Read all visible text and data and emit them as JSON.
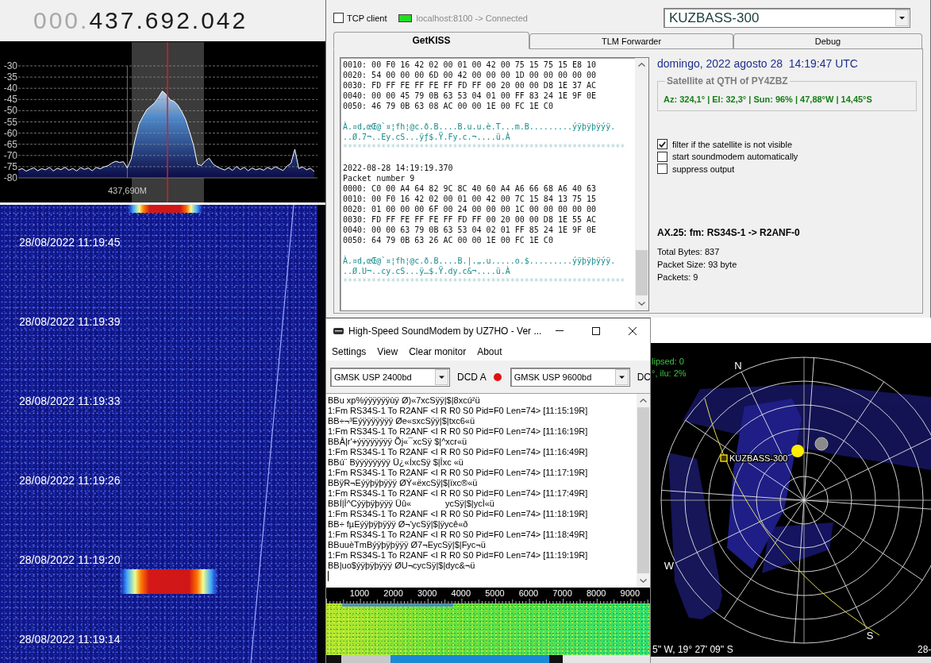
{
  "sdr": {
    "frequency": {
      "dim": "000.",
      "digits": "437.692.042"
    },
    "spectrum": {
      "chart_data": {
        "type": "line",
        "grid": true,
        "ylim": [
          -80,
          -30
        ],
        "yticks": [
          {
            "value": -30,
            "label": "-30"
          },
          {
            "value": -35,
            "label": "-35"
          },
          {
            "value": -40,
            "label": "-40"
          },
          {
            "value": -45,
            "label": "-45"
          },
          {
            "value": -50,
            "label": "-50"
          },
          {
            "value": -55,
            "label": "-55"
          },
          {
            "value": -60,
            "label": "-60"
          },
          {
            "value": -65,
            "label": "-65"
          },
          {
            "value": -70,
            "label": "-70"
          },
          {
            "value": -75,
            "label": "-75"
          },
          {
            "value": -80,
            "label": "-80"
          }
        ],
        "series": [
          {
            "color": "#ffffff",
            "values": [
              -76.5,
              -75.8,
              -77.0,
              -76.2,
              -75.5,
              -76.8,
              -75.9,
              -76.4,
              -75.3,
              -76.9,
              -75.7,
              -76.3,
              -75.2,
              -76.6,
              -75.8,
              -76.9,
              -75.4,
              -76.2,
              -75.6,
              -76.8,
              -75.3,
              -76.0,
              -75.1,
              -74.6,
              -73.4,
              -72.6,
              -73.1,
              -72.8,
              -75.6,
              -71.5,
              -63.0,
              -56.0,
              -52.5,
              -49.5,
              -48.0,
              -46.5,
              -44.0,
              -41.2,
              -42.8,
              -45.2,
              -45.8,
              -47.6,
              -50.5,
              -54.0,
              -59.5,
              -65.5,
              -74.0,
              -74.5,
              -72.5,
              -71.2,
              -73.8,
              -75.0,
              -75.8,
              -76.5,
              -75.4,
              -76.7,
              -74.9,
              -76.3,
              -75.2,
              -76.8,
              -75.6,
              -76.4,
              -75.9,
              -76.6,
              -75.3,
              -76.2,
              -75.0,
              -75.9,
              -76.7,
              -74.8,
              -73.5,
              -67.2,
              -75.8,
              -75.1,
              -76.4,
              -75.7,
              -77.2
            ]
          }
        ],
        "annotations": [
          {
            "text": "437,690M"
          }
        ]
      }
    },
    "waterfall": {
      "timestamps": [
        "28/08/2022 11:19:45",
        "28/08/2022 11:19:39",
        "28/08/2022 11:19:33",
        "28/08/2022 11:19:26",
        "28/08/2022 11:19:20",
        "28/08/2022 11:19:14"
      ]
    }
  },
  "getkiss": {
    "tcp_client": {
      "label": "TCP client",
      "checked": false
    },
    "connection": {
      "connected": true,
      "status": "localhost:8100 -> Connected"
    },
    "satellite": "KUZBASS-300",
    "tabs": [
      {
        "label": "GetKISS",
        "selected": true
      },
      {
        "label": "TLM Forwarder",
        "selected": false
      },
      {
        "label": "Debug",
        "selected": false
      }
    ],
    "log": [
      {
        "kind": "text",
        "text": "0010: 00 F0 16 42 02 00 01 00 42 00 75 15 75 15 E8 10"
      },
      {
        "kind": "text",
        "text": "0020: 54 00 00 00 6D 00 42 00 00 00 1D 00 00 00 00 00"
      },
      {
        "kind": "text",
        "text": "0030: FD FF FE FF FE FF FD FF 00 20 00 00 D8 1E 37 AC"
      },
      {
        "kind": "text",
        "text": "0040: 00 00 45 79 0B 63 53 04 01 00 FF 83 24 1E 9F 0E"
      },
      {
        "kind": "text",
        "text": "0050: 46 79 0B 63 08 AC 00 00 1E 00 FC 1E C0"
      },
      {
        "kind": "blank"
      },
      {
        "kind": "ascii",
        "text": "À.¤d,œŒ@`¤¦fh¦@c.ð.B....B.u.u.è.T...m.B.........ýÿþÿþÿýÿ."
      },
      {
        "kind": "ascii",
        "text": "..Ø.7¬..Ey.cS...ÿƒ$.Ÿ.Fy.c.¬....ü.À"
      },
      {
        "kind": "separator",
        "text": "***********************************************************"
      },
      {
        "kind": "blank"
      },
      {
        "kind": "text",
        "text": "2022-08-28 14:19:19.370"
      },
      {
        "kind": "text",
        "text": "Packet number 9"
      },
      {
        "kind": "text",
        "text": "0000: C0 00 A4 64 82 9C 8C 40 60 A4 A6 66 68 A6 40 63"
      },
      {
        "kind": "text",
        "text": "0010: 00 F0 16 42 02 00 01 00 42 00 7C 15 84 13 75 15"
      },
      {
        "kind": "text",
        "text": "0020: 01 00 00 00 6F 00 24 00 00 00 1C 00 00 00 00 00"
      },
      {
        "kind": "text",
        "text": "0030: FD FF FE FF FE FF FD FF 00 20 00 00 D8 1E 55 AC"
      },
      {
        "kind": "text",
        "text": "0040: 00 00 63 79 0B 63 53 04 02 01 FF 85 24 1E 9F 0E"
      },
      {
        "kind": "text",
        "text": "0050: 64 79 0B 63 26 AC 00 00 1E 00 FC 1E C0"
      },
      {
        "kind": "blank"
      },
      {
        "kind": "ascii",
        "text": "À.¤d,œŒ@`¤¦fh¦@c.ð.B....B.|.„.u.....o.$.........ýÿþÿþÿýÿ."
      },
      {
        "kind": "ascii",
        "text": "..Ø.U¬..cy.cS...ÿ…$.Ÿ.dy.c&¬....ü.À"
      },
      {
        "kind": "separator",
        "text": "***********************************************************"
      }
    ],
    "datetime": "domingo, 2022 agosto 28  14:19:47 UTC",
    "qth": {
      "title": "Satellite at QTH of PY4ZBZ",
      "position": "Az: 324,1° | El: 32,3° | Sun: 96% | 47,88°W | 14,45°S"
    },
    "options": [
      {
        "label": "filter if the satellite is not visible",
        "checked": true
      },
      {
        "label": "start soundmodem automatically",
        "checked": false
      },
      {
        "label": "suppress output",
        "checked": false
      }
    ],
    "ax25": "AX.25: fm: RS34S-1 -> R2ANF-0",
    "stats": [
      "Total Bytes: 837",
      "Packet Size: 93 byte",
      "Packets: 9"
    ]
  },
  "soundmodem": {
    "title": "High-Speed SoundModem by UZ7HO - Ver ...",
    "menu": [
      "Settings",
      "View",
      "Clear monitor",
      "About"
    ],
    "modem_a": {
      "mode": "GMSK USP 2400bd",
      "dcd_label": "DCD A",
      "dcd_lit": true
    },
    "modem_b": {
      "mode": "GMSK USP 9600bd",
      "dcd_label": "DC"
    },
    "monitor": [
      "BBu xp%ýÿÿÿÿÿùÿ Ø)«7xcSÿÿ|$|8xcú²ü",
      "1:Fm RS34S-1 To R2ANF <I R R0 S0 Pid=F0 Len=74> [11:15:19R]",
      "BB÷¬³Eýÿÿÿÿÿÿÿ Øe«sxcSÿÿ|$|txc6«ü",
      "1:Fm RS34S-1 To R2ANF <I R R0 S0 Pid=F0 Len=74> [11:16:19R]",
      "BBÂ|r'+ýÿÿÿÿÿÿÿ Õj«¯xcSÿ $|^xcr«ü",
      "1:Fm RS34S-1 To R2ANF <I R R0 S0 Pid=F0 Len=74> [11:16:49R]",
      "BBú¨ Býÿÿÿÿÿÿÿ Ü¿«ÍxcSÿ $|Îxc «ü",
      "1:Fm RS34S-1 To R2ANF <I R R0 S0 Pid=F0 Len=74> [11:17:19R]",
      "BBÿR¬Eýÿþÿþÿÿÿ ØÝ«ëxcSÿ|$|ïxc®«ü",
      "1:Fm RS34S-1 To R2ANF <I R R0 S0 Pid=F0 Len=74> [11:17:49R]",
      "BBÍ|Î^Cýÿþÿþÿÿÿ Üû«              ycSÿ|$|ycÌ«ü",
      "1:Fm RS34S-1 To R2ANF <I R R0 S0 Pid=F0 Len=74> [11:18:19R]",
      "BB÷ fµEýÿþÿþÿÿÿ Ø¬'ycSÿ|$|ÿycê«ð",
      "1:Fm RS34S-1 To R2ANF <I R R0 S0 Pid=F0 Len=74> [11:18:49R]",
      "BBuuèTmBýÿþÿþÿÿÿ Ø7¬EycSÿ|$|Fyc¬ü",
      "1:Fm RS34S-1 To R2ANF <I R R0 S0 Pid=F0 Len=74> [11:19:19R]",
      "BB|uo$ýÿþÿþÿÿÿ ØU¬cycSÿ|$|dyc&¬ü"
    ],
    "ruler": [
      "1000",
      "2000",
      "3000",
      "4000",
      "5000",
      "6000",
      "7000",
      "8000",
      "9000"
    ]
  },
  "sky_view": {
    "status": [
      "lipsed: 0",
      "°, ilu: 2%"
    ],
    "compass": [
      "N",
      "W",
      "S"
    ],
    "satellite": "KUZBASS-300",
    "location": "5'' W, 19° 27' 09'' S",
    "date": "28-"
  }
}
